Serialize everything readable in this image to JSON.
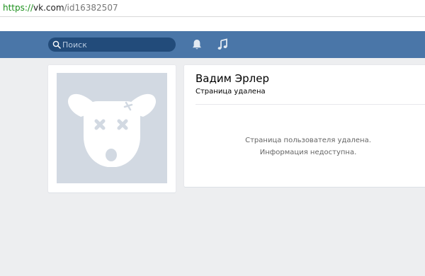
{
  "browser": {
    "url_scheme": "https://",
    "url_host": "vk.com",
    "url_path": "/id16382507"
  },
  "header": {
    "search_placeholder": "Поиск",
    "bell_icon": "bell-icon",
    "music_icon": "music-note-icon",
    "background_color": "#4a76a8"
  },
  "avatar": {
    "icon": "deleted-user-dog-icon",
    "background_color": "#d2d9e2"
  },
  "profile": {
    "name": "Вадим Эрлер",
    "status": "Страница удалена",
    "message_line1": "Страница пользователя удалена.",
    "message_line2": "Информация недоступна."
  }
}
